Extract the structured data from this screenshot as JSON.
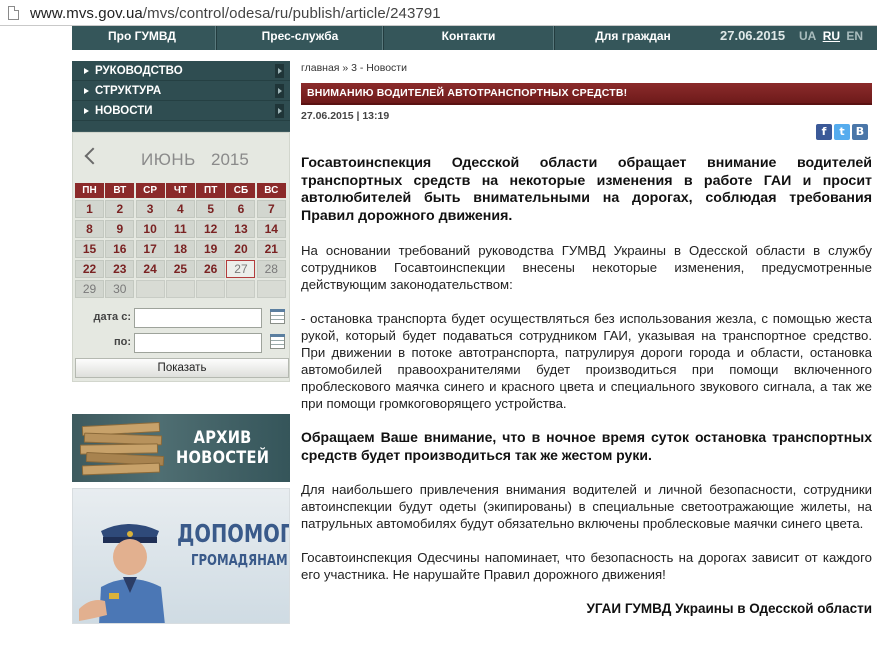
{
  "browser": {
    "url_host": "www.mvs.gov.ua",
    "url_path": "/mvs/control/odesa/ru/publish/article/243791"
  },
  "topnav": {
    "items": [
      "Про ГУМВД",
      "Прес-служба",
      "Контакти",
      "Для граждан"
    ],
    "date": "27.06.2015",
    "languages": [
      "UA",
      "RU",
      "EN"
    ],
    "active_language": "RU"
  },
  "sidebar": {
    "menu": [
      "РУКОВОДСТВО",
      "СТРУКТУРА",
      "НОВОСТИ"
    ]
  },
  "calendar": {
    "month": "ИЮНЬ",
    "year": "2015",
    "weekdays": [
      "ПН",
      "ВТ",
      "СР",
      "ЧТ",
      "ПТ",
      "СБ",
      "ВС"
    ],
    "weeks": [
      [
        "1",
        "2",
        "3",
        "4",
        "5",
        "6",
        "7"
      ],
      [
        "8",
        "9",
        "10",
        "11",
        "12",
        "13",
        "14"
      ],
      [
        "15",
        "16",
        "17",
        "18",
        "19",
        "20",
        "21"
      ],
      [
        "22",
        "23",
        "24",
        "25",
        "26",
        "27",
        "28"
      ],
      [
        "29",
        "30",
        "",
        "",
        "",
        "",
        ""
      ]
    ],
    "today": "27",
    "date_from_label": "дата с:",
    "date_to_label": "по:",
    "date_from_value": "",
    "date_to_value": "",
    "show_button": "Показать"
  },
  "banners": {
    "archive_line1": "АРХИВ",
    "archive_line2": "НОВОСТЕЙ",
    "help_line1": "ДОПОМОГА",
    "help_line2": "ГРОМАДЯНАМ"
  },
  "article": {
    "breadcrumb": "главная » 3 - Новости",
    "title": "ВНИМАНИЮ ВОДИТЕЛЕЙ АВТОТРАНСПОРТНЫХ СРЕДСТВ!",
    "meta": "27.06.2015 | 13:19",
    "lead": "Госавтоинспекция Одесской области обращает внимание водителей транспортных средств на некоторые изменения в работе ГАИ и просит автолюбителей быть внимательными на дорогах, соблюдая требования Правил дорожного движения.",
    "p1": "На основании требований руководства ГУМВД Украины в Одесской области в службу сотрудников Госавтоинспекции внесены некоторые изменения, предусмотренные действующим законодательством:",
    "p2": "- остановка транспорта будет осуществляться без использования жезла, с помощью жеста рукой, который будет подаваться сотрудником ГАИ, указывая на транспортное средство. При движении в потоке автотранспорта, патрулируя дороги города и области, остановка автомобилей правоохранителями будет производиться при помощи включенного проблескового маячка синего и красного цвета и специального звукового сигнала, а так же при помощи громкоговорящего устройства.",
    "p3": "Обращаем Ваше внимание, что в ночное время суток остановка транспортных средств будет производиться так же жестом руки.",
    "p4": "Для наибольшего привлечения внимания водителей и личной безопасности, сотрудники автоинспекции будут одеты (экипированы) в специальные светоотражающие жилеты, на патрульных автомобилях будут обязательно включены проблесковые маячки синего цвета.",
    "p5": "Госавтоинспекция Одесчины напоминает, что безопасность на дорогах зависит от каждого его участника. Не нарушайте Правил дорожного движения!",
    "signature": "УГАИ ГУМВД Украины в Одесской области"
  },
  "colors": {
    "nav_bg": "#35565a",
    "title_bar": "#7a2121",
    "calendar_header": "#8b2a2a",
    "calendar_bg": "#e5e8e1"
  }
}
